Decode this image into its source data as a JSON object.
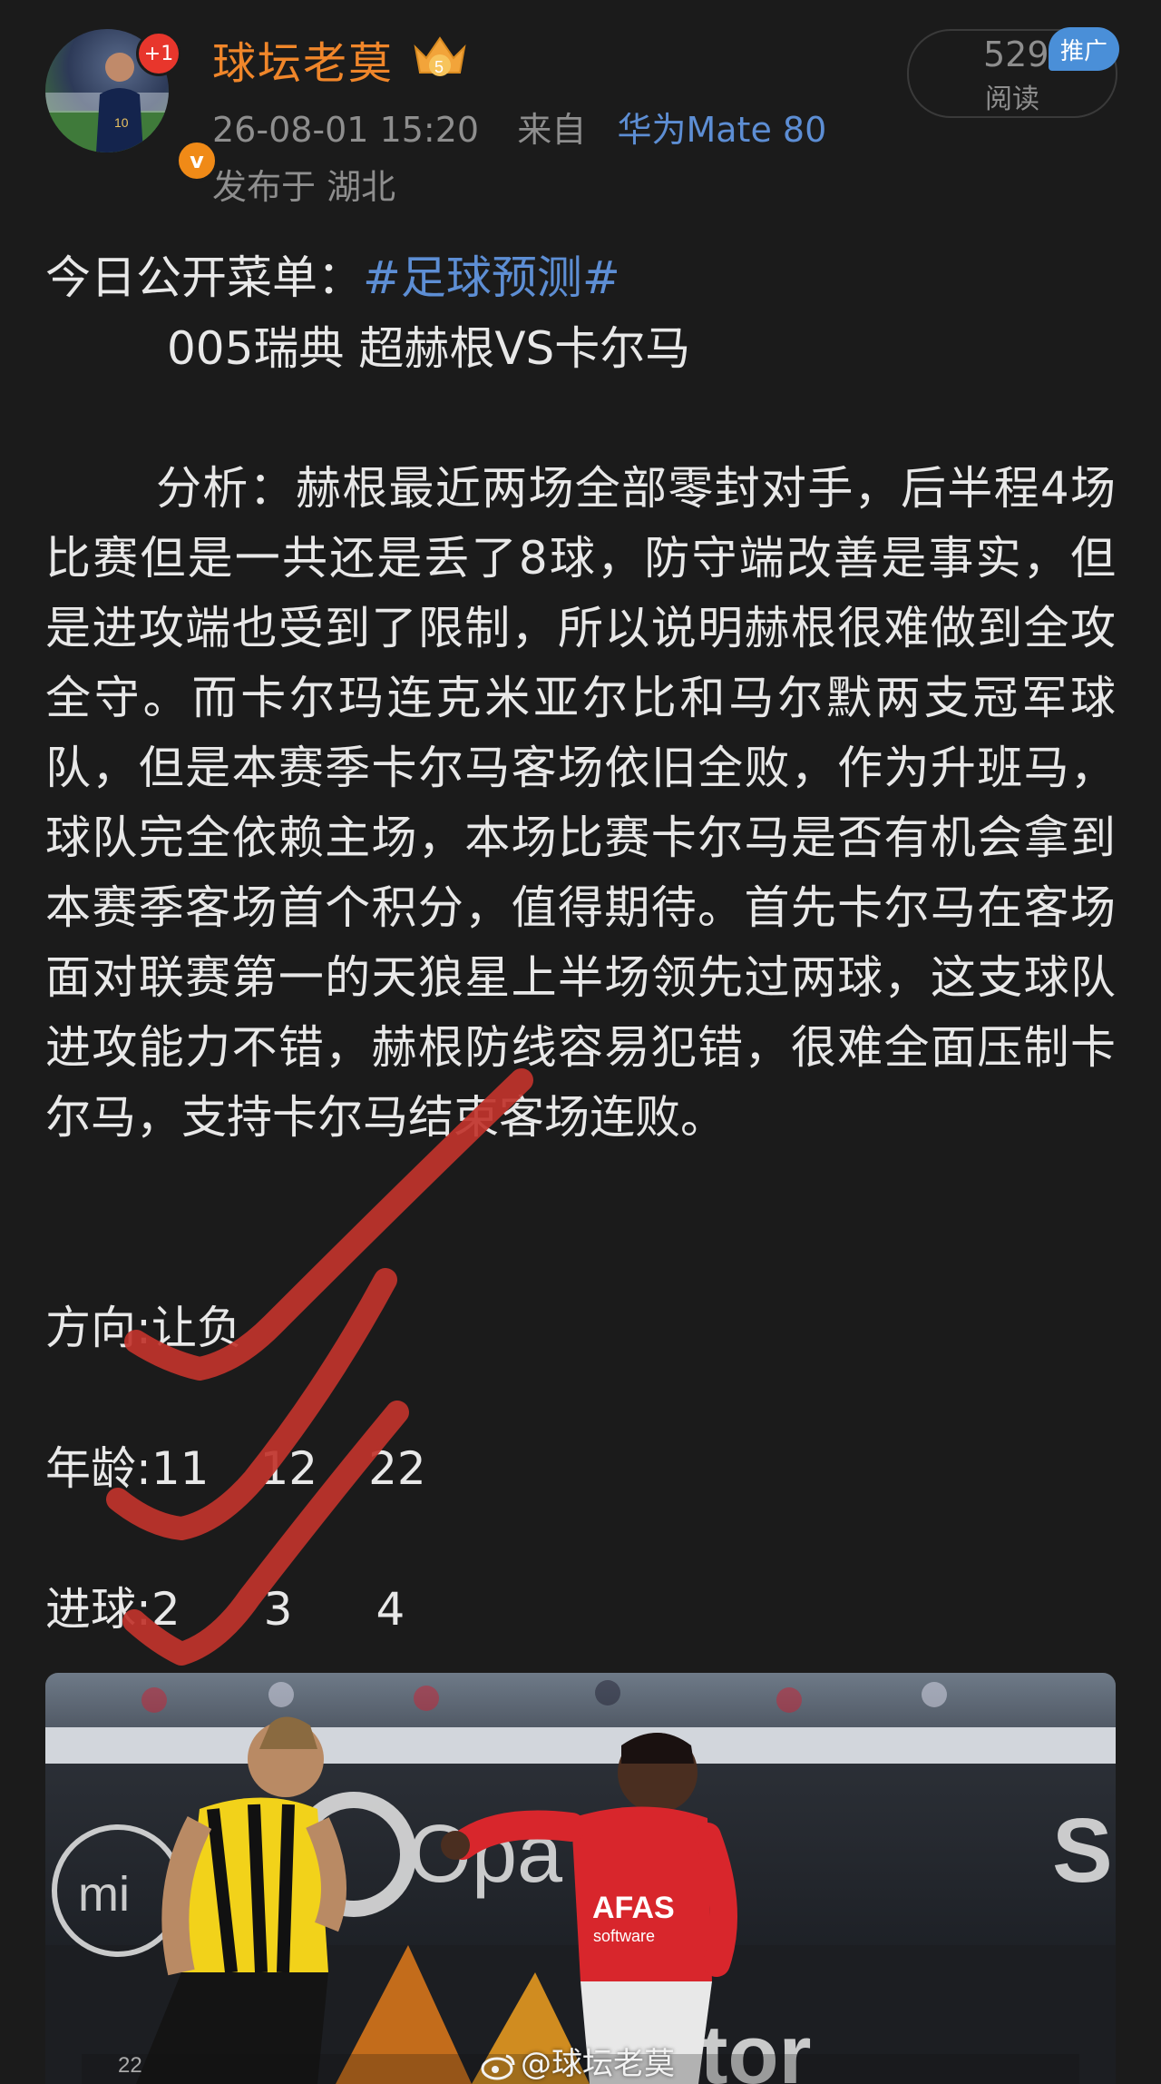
{
  "header": {
    "username": "球坛老莫",
    "notification_badge": "+1",
    "verified_badge": "v",
    "level_badge_number": "5",
    "timestamp": "26-08-01 15:20",
    "source_prefix": "来自",
    "device": "华为Mate 80",
    "location": "发布于 湖北",
    "reads_count": "529",
    "reads_label": "阅读",
    "promo_label": "推广"
  },
  "post": {
    "intro": "今日公开菜单：",
    "hashtag": "#足球预测#",
    "match": "005瑞典 超赫根VS卡尔马",
    "analysis": "分析：赫根最近两场全部零封对手，后半程4场比赛但是一共还是丢了8球，防守端改善是事实，但是进攻端也受到了限制，所以说明赫根很难做到全攻全守。而卡尔玛连克米亚尔比和马尔默两支冠军球队，但是本赛季卡尔马客场依旧全败，作为升班马，球队完全依赖主场，本场比赛卡尔马是否有机会拿到本赛季客场首个积分，值得期待。首先卡尔马在客场面对联赛第一的天狼星上半场领先过两球，这支球队进攻能力不错，赫根防线容易犯错，很难全面压制卡尔马，支持卡尔马结束客场连败。",
    "direction_label": "方向:",
    "direction_value": "让负",
    "age_label": "年龄:",
    "age_values": [
      "11",
      "12",
      "22"
    ],
    "goals_label": "进球:",
    "goals_values": [
      "2",
      "3",
      "4"
    ]
  },
  "photo": {
    "watermark": "@球坛老莫",
    "banner_texts": [
      "mi",
      "Opa",
      "AFAS Software",
      "nitor",
      "S"
    ],
    "player_numbers": [
      "22",
      "10"
    ]
  },
  "colors": {
    "background": "#1b1b1b",
    "username": "#f0862a",
    "link_blue": "#5d8ed4",
    "check_red": "#c0332b",
    "promo_blue": "#4a8fd8"
  }
}
